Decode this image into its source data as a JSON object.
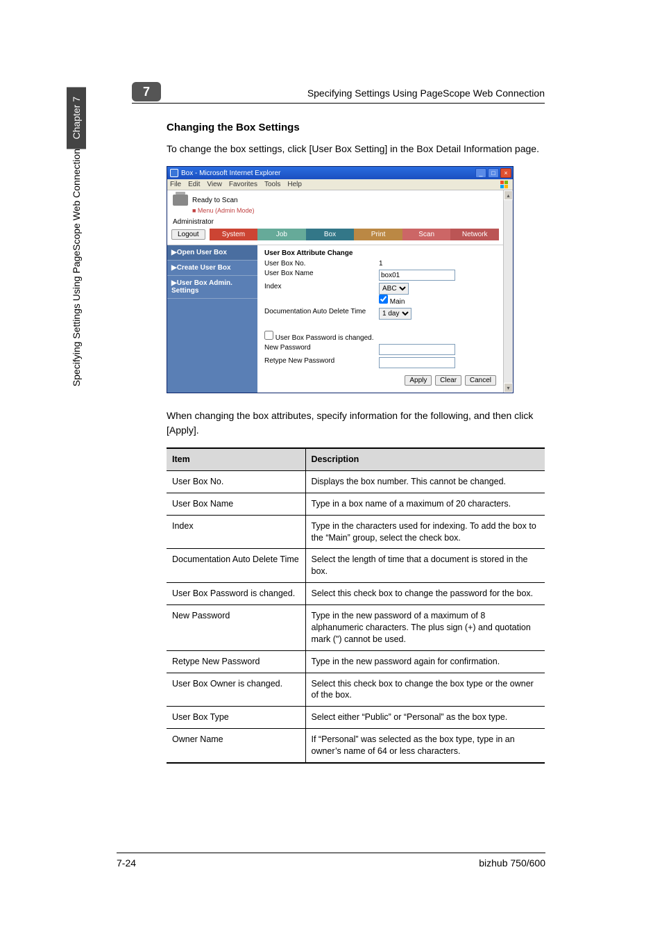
{
  "header": {
    "chapter_number": "7",
    "side_chapter": "Chapter 7",
    "side_title": "Specifying Settings Using PageScope Web Connection",
    "right_label": "Specifying Settings Using PageScope Web Connection"
  },
  "section": {
    "title": "Changing the Box Settings",
    "intro": "To change the box settings, click [User Box Setting] in the Box Detail Information page.",
    "after_image": "When changing the box attributes, specify information for the following, and then click [Apply]."
  },
  "browser": {
    "title": "Box - Microsoft Internet Explorer",
    "menus": [
      "File",
      "Edit",
      "View",
      "Favorites",
      "Tools",
      "Help"
    ],
    "status_top": "Ready to Scan",
    "status_menu": "■ Menu (Admin Mode)",
    "admin_label": "Administrator",
    "logout": "Logout",
    "tabs": {
      "system": "System",
      "job": "Job",
      "box": "Box",
      "print": "Print",
      "scan": "Scan",
      "network": "Network"
    },
    "sidenav": {
      "open": "▶Open User Box",
      "create": "▶Create User Box",
      "admin": "▶User Box Admin. Settings"
    },
    "form": {
      "group_title": "User Box Attribute Change",
      "no_label": "User Box No.",
      "no_value": "1",
      "name_label": "User Box Name",
      "name_value": "box01",
      "index_label": "Index",
      "index_select": "ABC",
      "main_label": "Main",
      "autodel_label": "Documentation Auto Delete Time",
      "autodel_select": "1 day",
      "pwchanged_label": "User Box Password is changed.",
      "newpw_label": "New Password",
      "retype_label": "Retype New Password",
      "buttons": {
        "apply": "Apply",
        "clear": "Clear",
        "cancel": "Cancel"
      }
    }
  },
  "table": {
    "head": {
      "item": "Item",
      "desc": "Description"
    },
    "rows": [
      {
        "item": "User Box No.",
        "desc": "Displays the box number. This cannot be changed."
      },
      {
        "item": "User Box Name",
        "desc": "Type in a box name of a maximum of 20 characters."
      },
      {
        "item": "Index",
        "desc": "Type in the characters used for indexing. To add the box to the “Main” group, select the check box."
      },
      {
        "item": "Documentation Auto Delete Time",
        "desc": "Select the length of time that a document is stored in the box."
      },
      {
        "item": "User Box Password is changed.",
        "desc": "Select this check box to change the password for the box."
      },
      {
        "item": "New Password",
        "desc": "Type in the new password of a maximum of 8 alphanumeric characters. The plus sign (+) and quotation mark (\") cannot be used."
      },
      {
        "item": "Retype New Password",
        "desc": "Type in the new password again for confirmation."
      },
      {
        "item": "User Box Owner is changed.",
        "desc": "Select this check box to change the box type or the owner of the box."
      },
      {
        "item": "User Box Type",
        "desc": "Select either “Public” or “Personal” as the box type."
      },
      {
        "item": "Owner Name",
        "desc": "If “Personal” was selected as the box type, type in an owner’s name of 64 or less characters."
      }
    ]
  },
  "footer": {
    "left": "7-24",
    "right": "bizhub 750/600"
  },
  "chart_data": {
    "type": "table",
    "columns": [
      "Item",
      "Description"
    ],
    "rows": [
      [
        "User Box No.",
        "Displays the box number. This cannot be changed."
      ],
      [
        "User Box Name",
        "Type in a box name of a maximum of 20 characters."
      ],
      [
        "Index",
        "Type in the characters used for indexing. To add the box to the “Main” group, select the check box."
      ],
      [
        "Documentation Auto Delete Time",
        "Select the length of time that a document is stored in the box."
      ],
      [
        "User Box Password is changed.",
        "Select this check box to change the password for the box."
      ],
      [
        "New Password",
        "Type in the new password of a maximum of 8 alphanumeric characters. The plus sign (+) and quotation mark (\") cannot be used."
      ],
      [
        "Retype New Password",
        "Type in the new password again for confirmation."
      ],
      [
        "User Box Owner is changed.",
        "Select this check box to change the box type or the owner of the box."
      ],
      [
        "User Box Type",
        "Select either “Public” or “Personal” as the box type."
      ],
      [
        "Owner Name",
        "If “Personal” was selected as the box type, type in an owner’s name of 64 or less characters."
      ]
    ]
  }
}
